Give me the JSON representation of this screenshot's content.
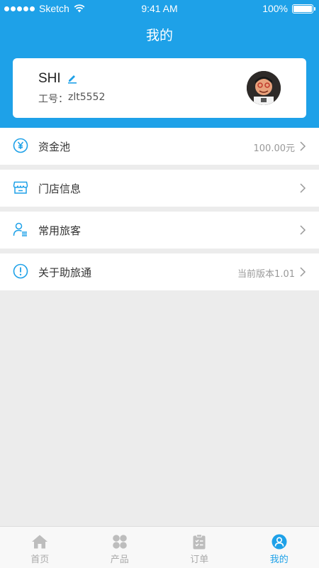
{
  "status_bar": {
    "carrier": "Sketch",
    "time": "9:41 AM",
    "battery": "100%"
  },
  "header": {
    "title": "我的"
  },
  "profile": {
    "name": "SHI",
    "employee_id_label": "工号：",
    "employee_id": "zlt5552"
  },
  "menu": [
    {
      "label": "资金池",
      "value": "100.00元",
      "icon": "yen-icon"
    },
    {
      "label": "门店信息",
      "value": "",
      "icon": "store-icon"
    },
    {
      "label": "常用旅客",
      "value": "",
      "icon": "traveler-icon"
    },
    {
      "label": "关于助旅通",
      "value": "当前版本1.01",
      "icon": "info-icon"
    }
  ],
  "tabs": [
    {
      "label": "首页",
      "icon": "home-icon"
    },
    {
      "label": "产品",
      "icon": "grid-icon"
    },
    {
      "label": "订单",
      "icon": "clipboard-icon"
    },
    {
      "label": "我的",
      "icon": "user-icon"
    }
  ],
  "colors": {
    "accent": "#1ea1e8",
    "background": "#ececec",
    "muted": "#aaaaaa"
  }
}
